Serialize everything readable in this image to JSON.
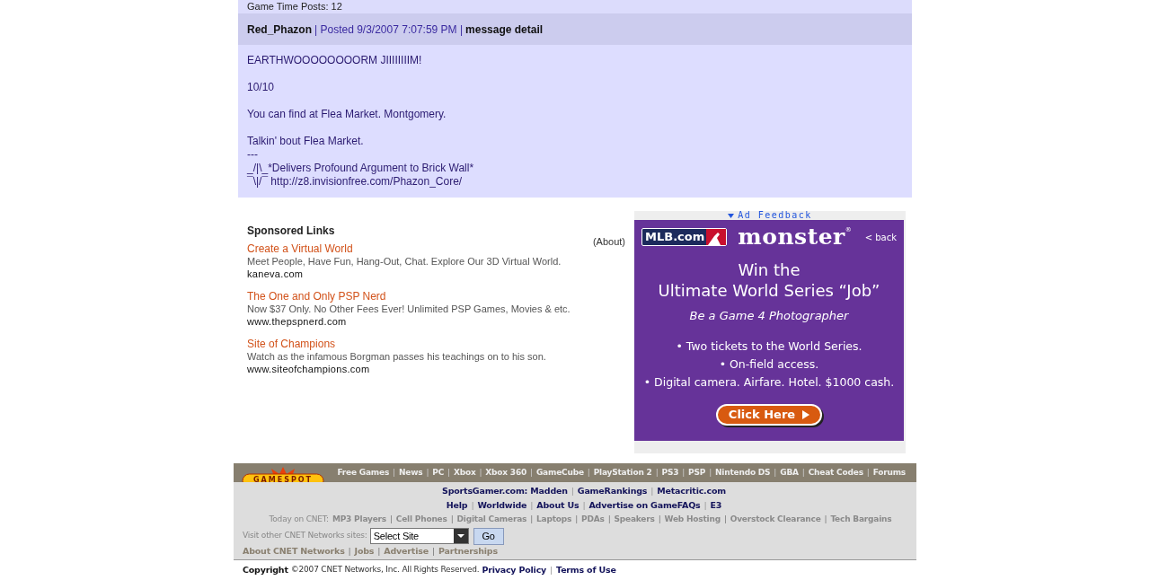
{
  "previous_post": {
    "text": "Game Time Posts: 12"
  },
  "post": {
    "author": "Red_Phazon",
    "posted": "| Posted 9/3/2007 7:07:59 PM |",
    "detail_link": "message detail",
    "paragraphs": [
      [
        "EARTHWOOOOOOOORM JIIIIIIIIM!"
      ],
      [
        "10/10"
      ],
      [
        "You can find at Flea Market. Montgomery."
      ],
      [
        "Talkin' bout Flea Market.",
        "---",
        "_/|\\_*Delivers Profound Argument to Brick Wall*",
        "¯\\|/¯ http://z8.invisionfree.com/Phazon_Core/"
      ]
    ]
  },
  "sponsored": {
    "title": "Sponsored Links",
    "about": "(About)",
    "ads": [
      {
        "title": "Create a Virtual World",
        "description": "Meet People, Have Fun, Hang-Out, Chat. Explore Our 3D Virtual World.",
        "url": "kaneva.com"
      },
      {
        "title": "The One and Only PSP Nerd",
        "description": "Now $37 Only. No Other Fees Ever! Unlimited PSP Games, Movies & etc.",
        "url": "www.thepspnerd.com"
      },
      {
        "title": "Site of Champions",
        "description": "Watch as the infamous Borgman passes his teachings on to his son.",
        "url": "www.siteofchampions.com"
      }
    ]
  },
  "banner": {
    "feedback": "Ad Feedback",
    "partner_logo": "MLB.com",
    "brand": "monster",
    "brand_mark": "®",
    "back": "< back",
    "headline": [
      "Win the",
      "Ultimate World Series “Job”"
    ],
    "subhead": "Be a Game 4 Photographer",
    "bullets": [
      "• Two tickets to the World Series.",
      "• On-field access.",
      "• Digital camera. Airfare. Hotel. $1000 cash."
    ],
    "button": "Click Here"
  },
  "footer": {
    "separator": "|",
    "logo": "GAMESPOT",
    "nav": [
      "Free Games",
      "News",
      "PC",
      "Xbox",
      "Xbox 360",
      "GameCube",
      "PlayStation 2",
      "PS3",
      "PSP",
      "Nintendo DS",
      "GBA",
      "Cheat Codes",
      "Forums"
    ],
    "partners_label": "SportsGamer.com: Madden",
    "partners": [
      "GameRankings",
      "Metacritic.com"
    ],
    "help_links": [
      "Help",
      "Worldwide",
      "About Us",
      "Advertise on GameFAQs",
      "E3"
    ],
    "today_label": "Today on CNET:",
    "today_links": [
      "MP3 Players",
      "Cell Phones",
      "Digital Cameras",
      "Laptops",
      "PDAs",
      "Speakers",
      "Web Hosting",
      "Overstock Clearance",
      "Tech Bargains"
    ],
    "sites_label": "Visit other CNET Networks sites:",
    "site_select": "Select Site",
    "go": "Go",
    "about_links": [
      "About CNET Networks",
      "Jobs",
      "Advertise",
      "Partnerships"
    ],
    "copyright_label": "Copyright",
    "copyright": "©2007 CNET Networks, Inc. All Rights Reserved.",
    "legal_links": [
      "Privacy Policy",
      "Terms of Use"
    ]
  }
}
